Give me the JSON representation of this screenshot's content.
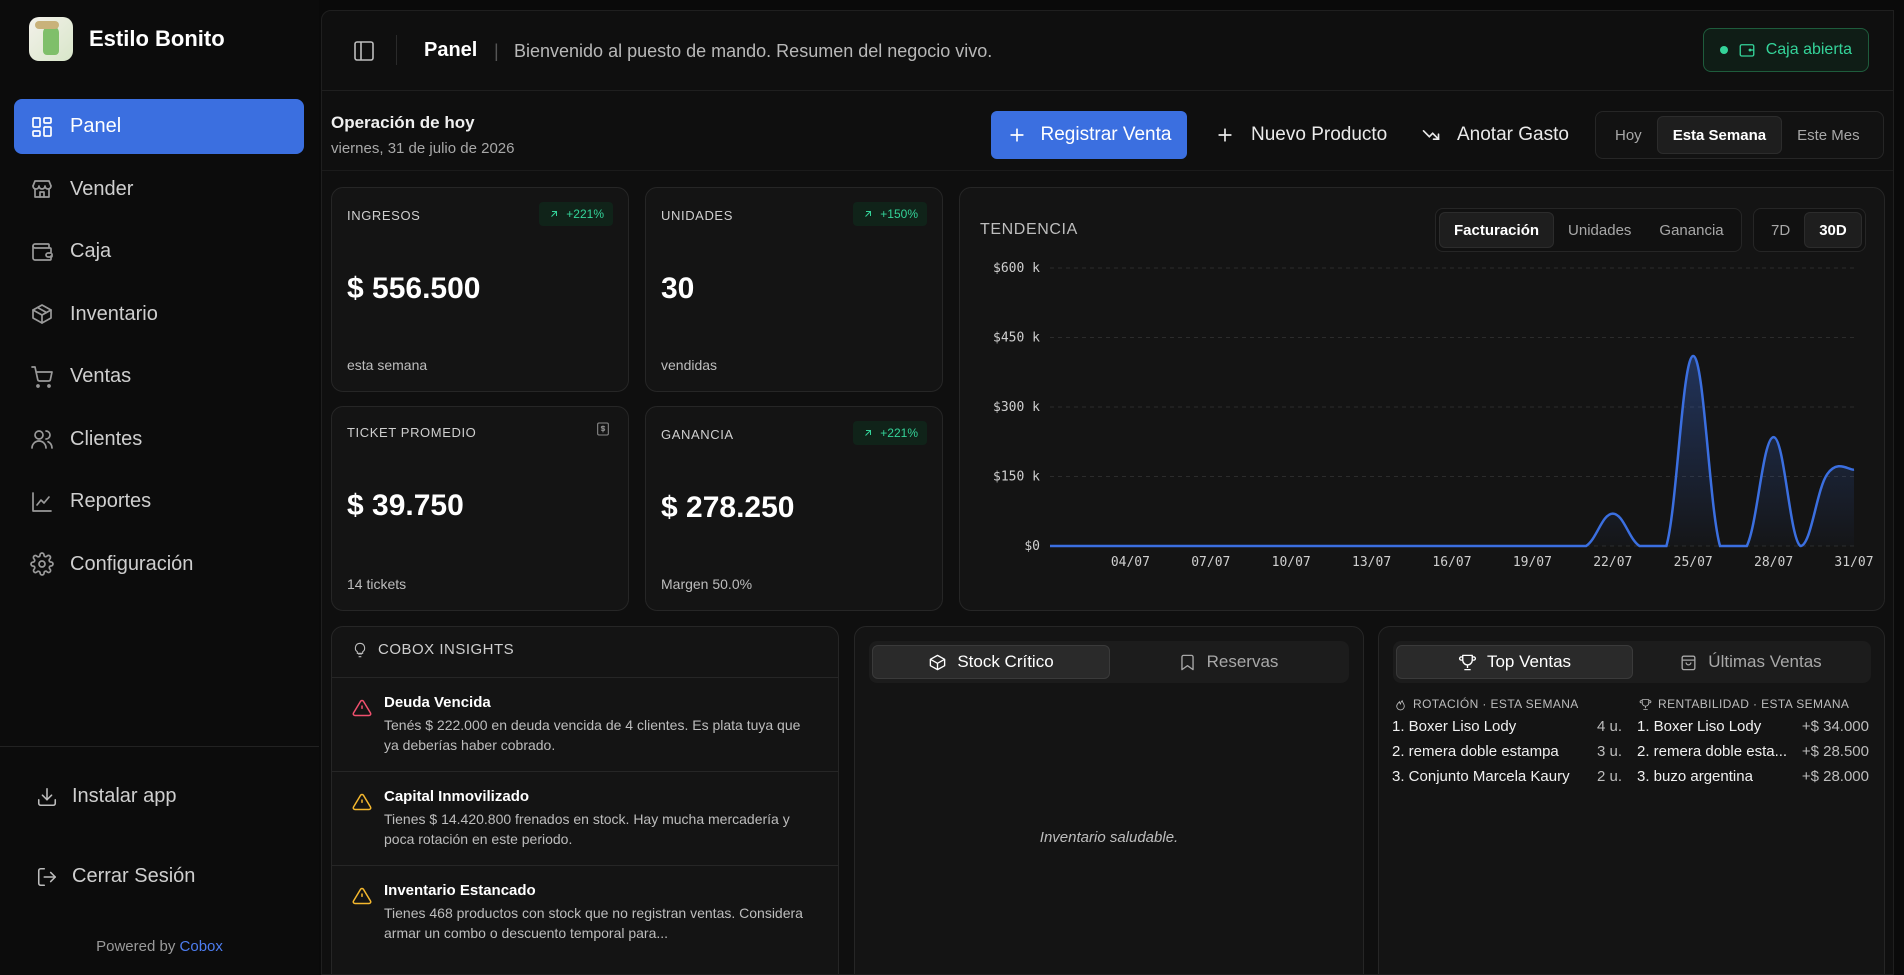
{
  "brand": {
    "name": "Estilo Bonito"
  },
  "sidebar": {
    "items": [
      {
        "label": "Panel",
        "icon": "grid-icon"
      },
      {
        "label": "Vender",
        "icon": "store-icon"
      },
      {
        "label": "Caja",
        "icon": "wallet-icon"
      },
      {
        "label": "Inventario",
        "icon": "box-icon"
      },
      {
        "label": "Ventas",
        "icon": "cart-icon"
      },
      {
        "label": "Clientes",
        "icon": "users-icon"
      },
      {
        "label": "Reportes",
        "icon": "chart-icon"
      },
      {
        "label": "Configuración",
        "icon": "gear-icon"
      }
    ],
    "install_label": "Instalar app",
    "logout_label": "Cerrar Sesión",
    "powered_prefix": "Powered by",
    "powered_brand": "Cobox"
  },
  "header": {
    "title": "Panel",
    "separator": "|",
    "subtitle": "Bienvenido al puesto de mando. Resumen del negocio vivo.",
    "status_badge": "Caja abierta",
    "status_color": "#34d399"
  },
  "ops": {
    "title": "Operación de hoy",
    "date": "viernes, 31 de julio de 2026",
    "register_sale": "Registrar Venta",
    "new_product": "Nuevo Producto",
    "log_expense": "Anotar Gasto",
    "ranges": [
      "Hoy",
      "Esta Semana",
      "Este Mes"
    ],
    "active_range": "Esta Semana"
  },
  "kpis": {
    "ingresos": {
      "label": "INGRESOS",
      "badge": "+221%",
      "value": "$ 556.500",
      "foot": "esta semana"
    },
    "unidades": {
      "label": "UNIDADES",
      "badge": "+150%",
      "value": "30",
      "foot": "vendidas"
    },
    "ticket": {
      "label": "TICKET PROMEDIO",
      "value": "$ 39.750",
      "foot": "14 tickets"
    },
    "ganancia": {
      "label": "GANANCIA",
      "badge": "+221%",
      "value": "$ 278.250",
      "foot": "Margen 50.0%"
    }
  },
  "trend": {
    "title": "TENDENCIA",
    "metrics": [
      "Facturación",
      "Unidades",
      "Ganancia"
    ],
    "active_metric": "Facturación",
    "periods": [
      "7D",
      "30D"
    ],
    "active_period": "30D",
    "line_color": "#3b6fe0"
  },
  "chart_data": {
    "type": "area",
    "y_ticks": [
      "$600 k",
      "$450 k",
      "$300 k",
      "$150 k",
      "$0"
    ],
    "ylim": [
      0,
      600000
    ],
    "x_ticks": [
      "04/07",
      "07/07",
      "10/07",
      "13/07",
      "16/07",
      "19/07",
      "22/07",
      "25/07",
      "28/07",
      "31/07"
    ],
    "x_days": [
      4,
      7,
      10,
      13,
      16,
      19,
      22,
      25,
      28,
      31
    ],
    "x": [
      1,
      2,
      3,
      4,
      5,
      6,
      7,
      8,
      9,
      10,
      11,
      12,
      13,
      14,
      15,
      16,
      17,
      18,
      19,
      20,
      21,
      22,
      23,
      24,
      25,
      26,
      27,
      28,
      29,
      30,
      31
    ],
    "values": [
      0,
      0,
      0,
      0,
      0,
      0,
      0,
      0,
      0,
      0,
      0,
      0,
      0,
      0,
      0,
      0,
      0,
      0,
      0,
      0,
      0,
      70000,
      0,
      0,
      410000,
      0,
      0,
      235000,
      0,
      155000,
      165000
    ],
    "grid": true
  },
  "insights": {
    "title": "COBOX INSIGHTS",
    "items": [
      {
        "title": "Deuda Vencida",
        "text": "Tenés $ 222.000 en deuda vencida de 4 clientes. Es plata tuya que ya deberías haber cobrado.",
        "color": "#f0506e"
      },
      {
        "title": "Capital Inmovilizado",
        "text": "Tienes $ 14.420.800 frenados en stock. Hay mucha mercadería y poca rotación en este periodo.",
        "color": "#f5b82e"
      },
      {
        "title": "Inventario Estancado",
        "text": "Tienes 468 productos con stock que no registran ventas. Considera armar un combo o descuento temporal para...",
        "color": "#f5b82e"
      }
    ]
  },
  "stock": {
    "tab_stock": "Stock Crítico",
    "tab_reservas": "Reservas",
    "empty": "Inventario saludable."
  },
  "top": {
    "tab_top": "Top Ventas",
    "tab_last": "Últimas Ventas",
    "rotation_head": "ROTACIÓN · ESTA SEMANA",
    "profit_head": "RENTABILIDAD · ESTA SEMANA",
    "rotation": [
      {
        "name": "1. Boxer Liso Lody",
        "qty": "4 u."
      },
      {
        "name": "2. remera doble estampa",
        "qty": "3 u."
      },
      {
        "name": "3. Conjunto Marcela Kaury",
        "qty": "2 u."
      }
    ],
    "profit": [
      {
        "name": "1. Boxer Liso Lody",
        "amount": "+$ 34.000"
      },
      {
        "name": "2. remera doble esta...",
        "amount": "+$ 28.500"
      },
      {
        "name": "3. buzo argentina",
        "amount": "+$ 28.000"
      }
    ]
  }
}
